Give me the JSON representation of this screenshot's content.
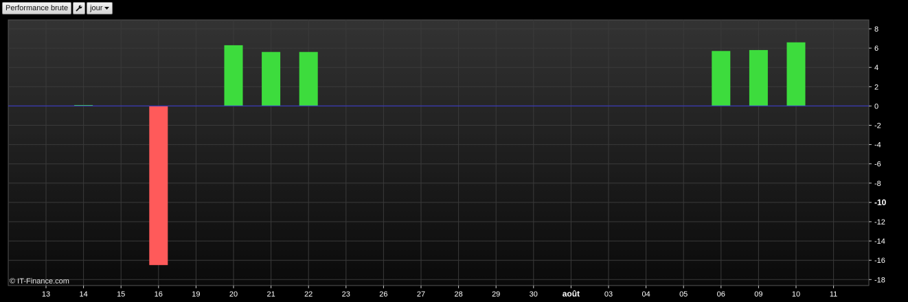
{
  "toolbar": {
    "indicator_label": "Performance brute",
    "settings_icon": "wrench-icon",
    "period_label": "jour",
    "dropdown_icon": "chevron-down-icon"
  },
  "copyright": "© IT-Finance.com",
  "colors": {
    "positive": "#3ddc3d",
    "negative": "#ff5a5a",
    "zero_line": "#3a3ab8",
    "grid": "#3a3a3a"
  },
  "chart_data": {
    "type": "bar",
    "categories": [
      "13",
      "14",
      "15",
      "16",
      "19",
      "20",
      "21",
      "22",
      "23",
      "26",
      "27",
      "28",
      "29",
      "30",
      "août",
      "03",
      "04",
      "05",
      "06",
      "09",
      "10",
      "11"
    ],
    "bold_categories": [
      "août"
    ],
    "values": [
      null,
      0.1,
      null,
      -16.5,
      null,
      6.3,
      5.6,
      5.6,
      null,
      null,
      null,
      null,
      null,
      null,
      null,
      null,
      null,
      null,
      5.7,
      5.8,
      6.6,
      null
    ],
    "ylim": [
      -18,
      9
    ],
    "yticks": [
      8,
      6,
      4,
      2,
      0,
      -2,
      -4,
      -6,
      -8,
      -10,
      -12,
      -14,
      -16,
      -18
    ],
    "bold_yticks": [
      -10
    ],
    "grid": true,
    "y_axis_position": "right"
  }
}
